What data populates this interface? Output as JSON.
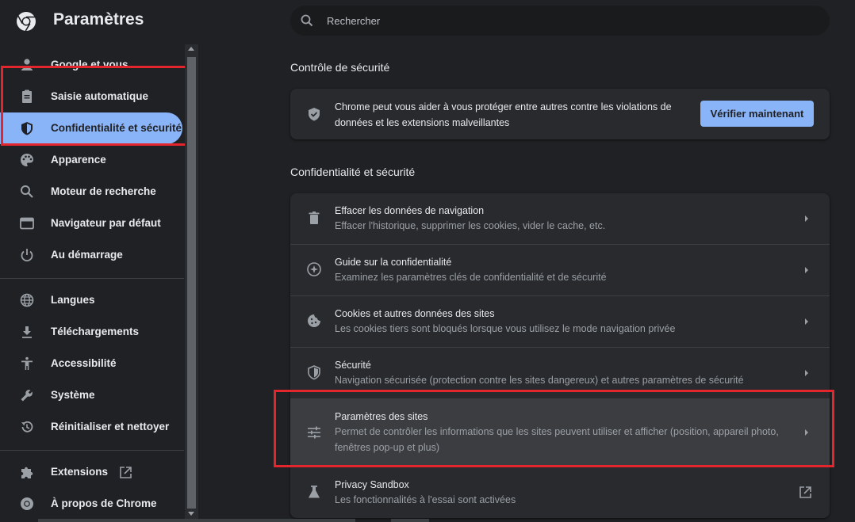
{
  "header": {
    "title": "Paramètres",
    "search_placeholder": "Rechercher"
  },
  "sidebar": {
    "items": [
      {
        "label": "Google et vous",
        "icon": "person-icon"
      },
      {
        "label": "Saisie automatique",
        "icon": "clipboard-icon"
      },
      {
        "label": "Confidentialité et sécurité",
        "icon": "shield-icon",
        "active": true
      },
      {
        "label": "Apparence",
        "icon": "palette-icon"
      },
      {
        "label": "Moteur de recherche",
        "icon": "search-icon"
      },
      {
        "label": "Navigateur par défaut",
        "icon": "browser-icon"
      },
      {
        "label": "Au démarrage",
        "icon": "power-icon"
      },
      {
        "label": "Langues",
        "icon": "globe-icon"
      },
      {
        "label": "Téléchargements",
        "icon": "download-icon"
      },
      {
        "label": "Accessibilité",
        "icon": "accessibility-icon"
      },
      {
        "label": "Système",
        "icon": "wrench-icon"
      },
      {
        "label": "Réinitialiser et nettoyer",
        "icon": "restore-icon"
      },
      {
        "label": "Extensions",
        "icon": "puzzle-icon"
      },
      {
        "label": "À propos de Chrome",
        "icon": "chrome-icon"
      }
    ]
  },
  "safety_check": {
    "title": "Contrôle de sécurité",
    "text": "Chrome peut vous aider à vous protéger entre autres contre les violations de données et les extensions malveillantes",
    "button_label": "Vérifier maintenant"
  },
  "privacy": {
    "title": "Confidentialité et sécurité",
    "rows": [
      {
        "title": "Effacer les données de navigation",
        "subtitle": "Effacer l'historique, supprimer les cookies, vider le cache, etc.",
        "icon": "trash-icon"
      },
      {
        "title": "Guide sur la confidentialité",
        "subtitle": "Examinez les paramètres clés de confidentialité et de sécurité",
        "icon": "compass-icon"
      },
      {
        "title": "Cookies et autres données des sites",
        "subtitle": "Les cookies tiers sont bloqués lorsque vous utilisez le mode navigation privée",
        "icon": "cookie-icon"
      },
      {
        "title": "Sécurité",
        "subtitle": "Navigation sécurisée (protection contre les sites dangereux) et autres paramètres de sécurité",
        "icon": "shield-icon"
      },
      {
        "title": "Paramètres des sites",
        "subtitle": "Permet de contrôler les informations que les sites peuvent utiliser et afficher (position, appareil photo, fenêtres pop-up et plus)",
        "icon": "sliders-icon"
      },
      {
        "title": "Privacy Sandbox",
        "subtitle": "Les fonctionnalités à l'essai sont activées",
        "icon": "flask-icon"
      }
    ]
  },
  "colors": {
    "accent": "#8ab4f8",
    "background": "#202124",
    "card": "#292a2d",
    "highlight": "#e3262d"
  }
}
